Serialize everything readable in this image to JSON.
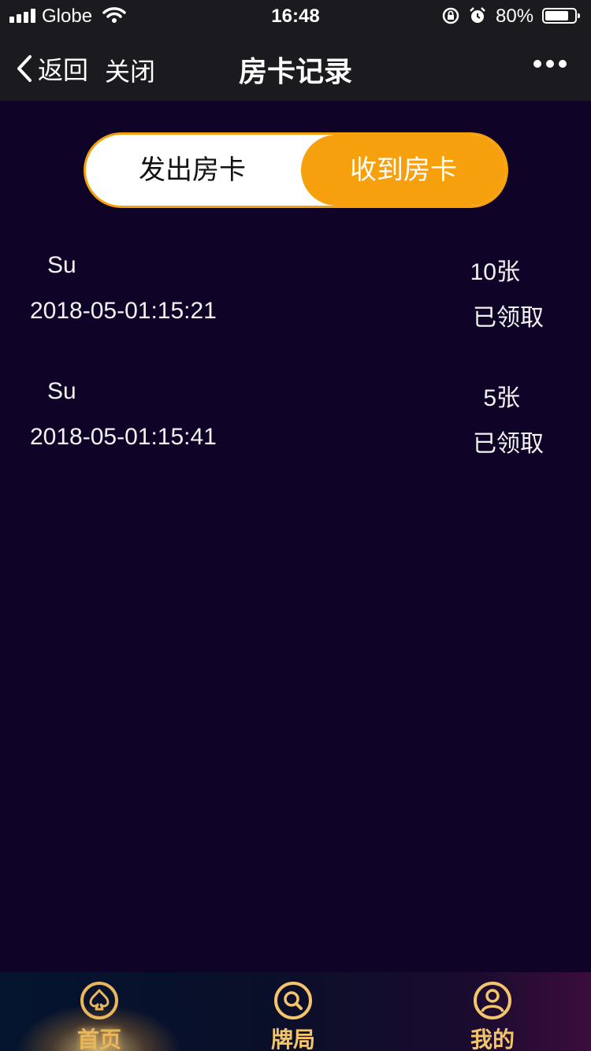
{
  "status_bar": {
    "carrier": "Globe",
    "time": "16:48",
    "battery_pct": "80%",
    "battery_level": 0.8
  },
  "nav": {
    "back_label": "返回",
    "close_label": "关闭",
    "title": "房卡记录"
  },
  "segmented": {
    "sent_label": "发出房卡",
    "received_label": "收到房卡",
    "active": "received"
  },
  "records": [
    {
      "name": "Su",
      "time": "2018-05-01:15:21",
      "count": "10张",
      "status": "已领取"
    },
    {
      "name": "Su",
      "time": "2018-05-01:15:41",
      "count": "5张",
      "status": "已领取"
    }
  ],
  "tabbar": {
    "items": [
      {
        "label": "首页",
        "icon": "spade-icon",
        "active": true
      },
      {
        "label": "牌局",
        "icon": "search-icon",
        "active": false
      },
      {
        "label": "我的",
        "icon": "user-icon",
        "active": false
      }
    ]
  },
  "colors": {
    "background": "#0f0427",
    "accent": "#f5a00c",
    "tab_gold": "#f3c56b"
  }
}
